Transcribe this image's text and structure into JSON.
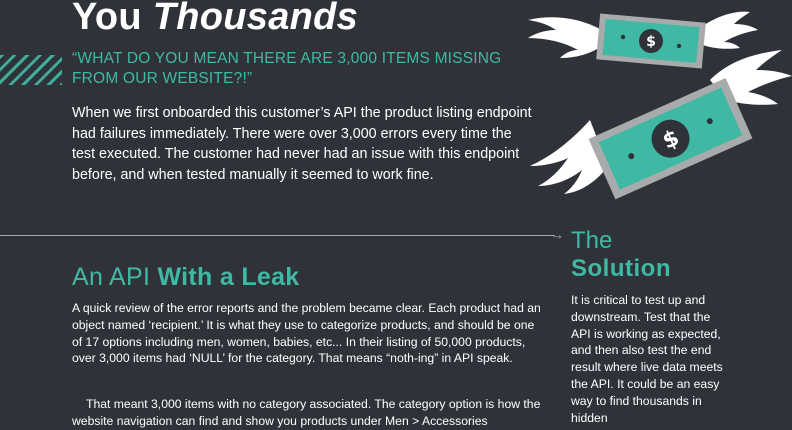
{
  "header": {
    "headline_prefix": "You ",
    "headline_italic": "Thousands",
    "quote": "“WHAT DO YOU MEAN THERE ARE 3,000 ITEMS MISSING FROM OUR WEBSITE?!”",
    "intro": "When we first onboarded this customer’s API the product listing endpoint had failures immediately. There were over 3,000 errors every time the test executed. The customer had never had an issue with this endpoint before, and when tested manually it seemed to work fine."
  },
  "leak_section": {
    "heading_light": "An API ",
    "heading_bold": "With a Leak",
    "paragraph_1": "A quick review of the error reports and the problem became clear. Each product had an object named ‘recipient.’ It is what they use to categorize products, and should be one of 17 options including men, women, babies, etc... In their listing of 50,000 products, over 3,000 items had ‘NULL’ for the category. That means “noth-ing” in API speak.",
    "paragraph_2": "That meant 3,000 items with no category associated. The category option is how the website navigation can find and show you products under Men > Accessories"
  },
  "solution_section": {
    "heading_light": "The",
    "heading_bold": "Solution",
    "text": "It is critical to test up and downstream. Test that the API is working as expected, and then also test the end result where live data meets the API. It could be an easy way to find thousands in hidden"
  },
  "illustration": {
    "small_bill_symbol": "$",
    "large_bill_symbol": "$",
    "accent_color": "#3fb9a4",
    "bill_gray": "#a9aaab",
    "wing_color": "#ffffff"
  }
}
